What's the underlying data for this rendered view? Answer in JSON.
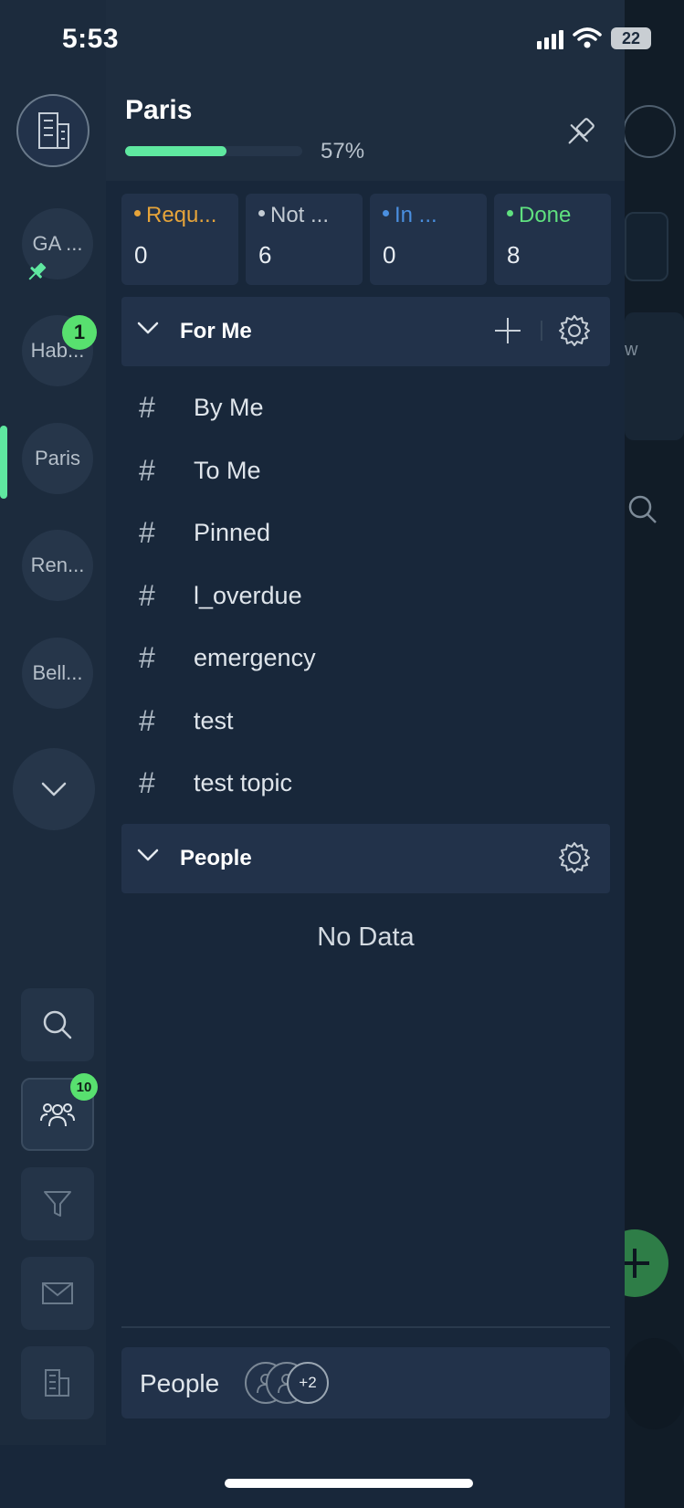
{
  "status_bar": {
    "time": "5:53",
    "battery": "22"
  },
  "workspace": {
    "title": "Paris",
    "progress": 57,
    "progress_label": "57%"
  },
  "rail": {
    "items": [
      {
        "label": "GA ...",
        "pinned": true
      },
      {
        "label": "Hab...",
        "badge": "1"
      },
      {
        "label": "Paris",
        "active": true
      },
      {
        "label": "Ren..."
      },
      {
        "label": "Bell..."
      }
    ],
    "people_badge": "10",
    "tools": [
      "search-icon",
      "people-icon",
      "filter-icon",
      "mail-icon",
      "building-icon"
    ]
  },
  "stats": [
    {
      "label": "Requ...",
      "value": "0",
      "color": "#e6a43a"
    },
    {
      "label": "Not ...",
      "value": "6",
      "color": "#c3cbd3"
    },
    {
      "label": "In ...",
      "value": "0",
      "color": "#4a8fe0"
    },
    {
      "label": "Done",
      "value": "8",
      "color": "#5fe07f"
    }
  ],
  "for_me": {
    "title": "For Me",
    "topics": [
      "By Me",
      "To Me",
      "Pinned",
      "l_overdue",
      "emergency",
      "test",
      "test topic"
    ],
    "hash": "#"
  },
  "people_section": {
    "title": "People",
    "empty_text": "No Data"
  },
  "people_bar": {
    "label": "People",
    "more": "+2"
  }
}
